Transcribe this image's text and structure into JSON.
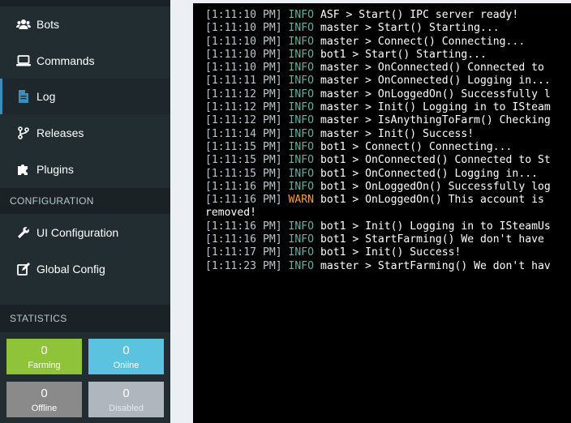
{
  "sidebar": {
    "items_top": [
      {
        "label": "Bots",
        "icon": "users-icon"
      },
      {
        "label": "Commands",
        "icon": "laptop-icon"
      },
      {
        "label": "Log",
        "icon": "file-icon",
        "active": true
      },
      {
        "label": "Releases",
        "icon": "code-branch-icon"
      },
      {
        "label": "Plugins",
        "icon": "puzzle-icon"
      }
    ],
    "configuration_header": "CONFIGURATION",
    "items_config": [
      {
        "label": "UI Configuration",
        "icon": "wrench-icon"
      },
      {
        "label": "Global Config",
        "icon": "edit-icon"
      }
    ],
    "statistics_header": "STATISTICS",
    "stats": [
      {
        "value": "0",
        "label": "Farming",
        "color": "#8fc33a"
      },
      {
        "value": "0",
        "label": "Online",
        "color": "#5bc3df"
      },
      {
        "value": "0",
        "label": "Offline",
        "color": "#8a8a8a"
      },
      {
        "value": "0",
        "label": "Disabled",
        "color": "#b0b6bd"
      }
    ]
  },
  "log": {
    "lines": [
      {
        "ts": "[1:11:10 PM]",
        "level": "INFO",
        "text": "ASF > Start() IPC server ready!"
      },
      {
        "ts": "[1:11:10 PM]",
        "level": "INFO",
        "text": "master > Start() Starting..."
      },
      {
        "ts": "[1:11:10 PM]",
        "level": "INFO",
        "text": "master > Connect() Connecting..."
      },
      {
        "ts": "[1:11:10 PM]",
        "level": "INFO",
        "text": "bot1 > Start() Starting..."
      },
      {
        "ts": "[1:11:10 PM]",
        "level": "INFO",
        "text": "master > OnConnected() Connected to"
      },
      {
        "ts": "[1:11:11 PM]",
        "level": "INFO",
        "text": "master > OnConnected() Logging in..."
      },
      {
        "ts": "[1:11:12 PM]",
        "level": "INFO",
        "text": "master > OnLoggedOn() Successfully l"
      },
      {
        "ts": "[1:11:12 PM]",
        "level": "INFO",
        "text": "master > Init() Logging in to ISteam"
      },
      {
        "ts": "[1:11:12 PM]",
        "level": "INFO",
        "text": "master > IsAnythingToFarm() Checking"
      },
      {
        "ts": "[1:11:14 PM]",
        "level": "INFO",
        "text": "master > Init() Success!"
      },
      {
        "ts": "[1:11:15 PM]",
        "level": "INFO",
        "text": "bot1 > Connect() Connecting..."
      },
      {
        "ts": "[1:11:15 PM]",
        "level": "INFO",
        "text": "bot1 > OnConnected() Connected to St"
      },
      {
        "ts": "[1:11:15 PM]",
        "level": "INFO",
        "text": "bot1 > OnConnected() Logging in..."
      },
      {
        "ts": "[1:11:16 PM]",
        "level": "INFO",
        "text": "bot1 > OnLoggedOn() Successfully log"
      },
      {
        "ts": "[1:11:16 PM]",
        "level": "WARN",
        "text": "bot1 > OnLoggedOn() This account is"
      },
      {
        "ts": "",
        "level": "",
        "text": "removed!"
      },
      {
        "ts": "[1:11:16 PM]",
        "level": "INFO",
        "text": "bot1 > Init() Logging in to ISteamUs"
      },
      {
        "ts": "[1:11:16 PM]",
        "level": "INFO",
        "text": "bot1 > StartFarming() We don't have"
      },
      {
        "ts": "[1:11:17 PM]",
        "level": "INFO",
        "text": "bot1 > Init() Success!"
      },
      {
        "ts": "[1:11:23 PM]",
        "level": "INFO",
        "text": "master > StartFarming() We don't hav"
      }
    ]
  }
}
